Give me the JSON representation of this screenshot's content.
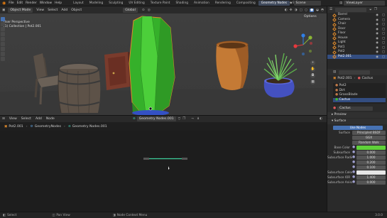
{
  "topbar": {
    "menus": [
      "File",
      "Edit",
      "Render",
      "Window",
      "Help"
    ],
    "workspaces": [
      "Layout",
      "Modeling",
      "Sculpting",
      "UV Editing",
      "Texture Paint",
      "Shading",
      "Animation",
      "Rendering",
      "Compositing",
      "Geometry Nodes",
      "Scripting"
    ],
    "active_workspace": "Geometry Nodes",
    "scene": "Scene",
    "view_layer": "ViewLayer"
  },
  "viewport": {
    "mode": "Object Mode",
    "menus": [
      "View",
      "Select",
      "Add",
      "Object"
    ],
    "orientation": "Global",
    "options": "Options",
    "info_line1": "User Perspective",
    "info_line2": "(1) Collection | Pot2.001"
  },
  "node_editor": {
    "menus": [
      "View",
      "Select",
      "Add",
      "Node"
    ],
    "tree": "Geometry Nodes.001",
    "breadcrumb": [
      "Pot2.001",
      "GeometryNodes",
      "Geometry Nodes.001"
    ]
  },
  "statusbar": {
    "left": "Select",
    "mid": "Pan View",
    "right": "Node Context Menu",
    "version": "3.0.0"
  },
  "outliner": {
    "items": [
      {
        "label": "Barrel",
        "selected": false
      },
      {
        "label": "Camera",
        "selected": false
      },
      {
        "label": "Chair",
        "selected": false
      },
      {
        "label": "Door",
        "selected": false
      },
      {
        "label": "Floor",
        "selected": false
      },
      {
        "label": "House",
        "selected": false
      },
      {
        "label": "Light",
        "selected": false
      },
      {
        "label": "Pot1",
        "selected": false
      },
      {
        "label": "Pot2",
        "selected": false
      },
      {
        "label": "Pot2.001",
        "selected": true
      }
    ]
  },
  "properties": {
    "object": "Pot2.001",
    "material_header": "Cactus",
    "materials": [
      "Pot2",
      "Dirt",
      "GrassBlade",
      "Cactus"
    ],
    "material_selected": "Cactus",
    "material_name": "Cactus",
    "preview_label": "Preview",
    "surface_label": "Surface",
    "use_nodes": "Use Nodes",
    "surface_row_label": "Surface",
    "surface_value": "Principled BSDF",
    "distribution": "GGX",
    "subsurface_method": "Random Walk",
    "fields": [
      {
        "label": "Base Color",
        "value": ""
      },
      {
        "label": "Subsurface",
        "value": "0.000"
      },
      {
        "label": "Subsurface Radius",
        "value": "1.000"
      },
      {
        "label": "",
        "value": "0.200"
      },
      {
        "label": "",
        "value": "0.100"
      },
      {
        "label": "Subsurface Color",
        "value": ""
      },
      {
        "label": "Subsurface IOR",
        "value": "1.400"
      },
      {
        "label": "Subsurface Anisotropy",
        "value": "0.000"
      }
    ]
  },
  "colors": {
    "accent": "#4772b3",
    "base_color": "#5fd13a",
    "cactus_green": "#3ec22d",
    "selected_outline": "#e08a2b"
  }
}
